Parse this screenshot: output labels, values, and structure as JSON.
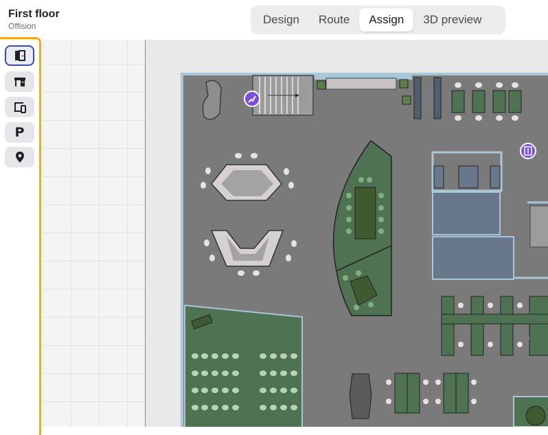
{
  "header": {
    "title": "First floor",
    "subtitle": "Offision"
  },
  "tabs": [
    {
      "label": "Design",
      "active": false
    },
    {
      "label": "Route",
      "active": false
    },
    {
      "label": "Assign",
      "active": true
    },
    {
      "label": "3D preview",
      "active": false
    }
  ],
  "tools": [
    {
      "icon": "room-door-icon",
      "active": true
    },
    {
      "icon": "desk-icon",
      "active": false
    },
    {
      "icon": "devices-icon",
      "active": false
    },
    {
      "icon": "parking-icon",
      "active": false,
      "glyph": "P"
    },
    {
      "icon": "location-pin-icon",
      "active": false
    }
  ],
  "colors": {
    "accent_orange": "#f5a623",
    "active_tool_border": "#3c4ca8",
    "floor": "#7a7a7a",
    "room_green": "#4f7352",
    "marker_purple": "#7b4fe0",
    "glass_wall": "#a9c7d6"
  }
}
